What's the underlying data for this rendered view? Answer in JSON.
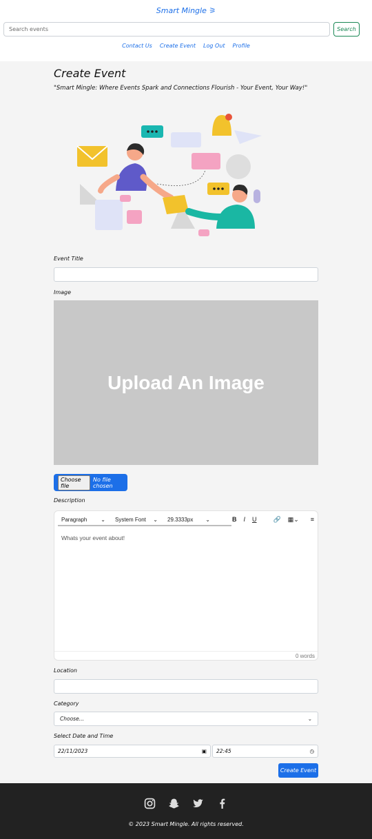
{
  "header": {
    "brand": "Smart Mingle ⚞",
    "search_placeholder": "Search events",
    "search_button": "Search",
    "nav": [
      "Contact Us",
      "Create Event",
      "Log Out",
      "Profile"
    ]
  },
  "page": {
    "title": "Create Event",
    "tagline": "\"Smart Mingle: Where Events Spark and Connections Flourish - Your Event, Your Way!\""
  },
  "form": {
    "event_title_label": "Event Title",
    "event_title_value": "",
    "image_label": "Image",
    "upload_text": "Upload An Image",
    "file_choose": "Choose file",
    "file_status": "No file chosen",
    "description_label": "Description",
    "editor": {
      "block": "Paragraph",
      "font": "System Font",
      "size": "29.3333px",
      "bold": "B",
      "italic": "I",
      "underline": "U",
      "placeholder": "Whats your event about!",
      "word_count": "0 words"
    },
    "location_label": "Location",
    "location_value": "",
    "category_label": "Category",
    "category_selected": "Choose...",
    "datetime_label": "Select Date and Time",
    "date_value": "22/11/2023",
    "time_value": "22:45",
    "submit": "Create Event"
  },
  "footer": {
    "icons": [
      "instagram-icon",
      "snapchat-icon",
      "twitter-icon",
      "facebook-icon"
    ],
    "copyright": "© 2023 Smart Mingle. All rights reserved."
  },
  "colors": {
    "primary": "#1c6fe8",
    "success": "#198754",
    "footer_bg": "#222222",
    "upload_bg": "#c8c8c8"
  }
}
